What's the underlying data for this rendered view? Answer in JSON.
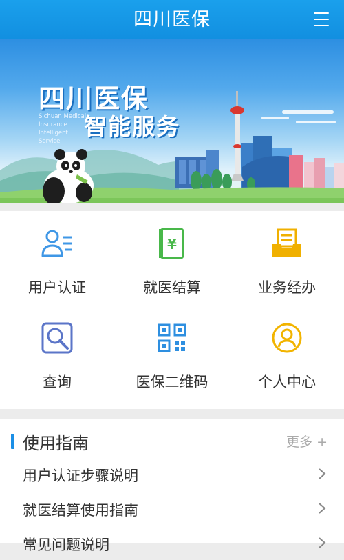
{
  "header": {
    "title": "四川医保",
    "menu_icon": "menu-icon"
  },
  "banner": {
    "title": "四川医保",
    "subtitle": "智能服务",
    "english_lines": [
      "Sichuan Medical",
      "Insurance",
      "Intelligent Service"
    ]
  },
  "services": [
    {
      "label": "用户认证",
      "icon": "user-list-icon",
      "color": "#3f97e6"
    },
    {
      "label": "就医结算",
      "icon": "ledger-icon",
      "color": "#49b84a"
    },
    {
      "label": "业务经办",
      "icon": "inbox-icon",
      "color": "#f0b000"
    },
    {
      "label": "查询",
      "icon": "magnifier-icon",
      "color": "#5b75c8"
    },
    {
      "label": "医保二维码",
      "icon": "qr-code-icon",
      "color": "#2e8fe0"
    },
    {
      "label": "个人中心",
      "icon": "person-circle-icon",
      "color": "#f2b400"
    }
  ],
  "guide": {
    "title": "使用指南",
    "more": "更多 +",
    "items": [
      {
        "label": "用户认证步骤说明"
      },
      {
        "label": "就医结算使用指南"
      },
      {
        "label": "常见问题说明"
      }
    ]
  },
  "colors": {
    "header_blue": "#1598e6",
    "accent_bar": "#1b8fe6",
    "text": "#333333",
    "muted": "#aaaaaa"
  }
}
